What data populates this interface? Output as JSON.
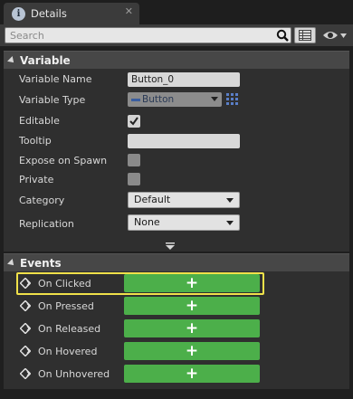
{
  "tab": {
    "label": "Details",
    "icon": "info-icon",
    "close_glyph": "✕"
  },
  "search": {
    "placeholder": "Search"
  },
  "variable_section": {
    "title": "Variable"
  },
  "variable_rows": {
    "variable_name": {
      "label": "Variable Name",
      "value": "Button_0"
    },
    "variable_type": {
      "label": "Variable Type",
      "value": "Button"
    },
    "editable": {
      "label": "Editable",
      "checked": true
    },
    "tooltip": {
      "label": "Tooltip",
      "value": ""
    },
    "expose_on_spawn": {
      "label": "Expose on Spawn",
      "checked": false
    },
    "private": {
      "label": "Private",
      "checked": false
    },
    "category": {
      "label": "Category",
      "value": "Default"
    },
    "replication": {
      "label": "Replication",
      "value": "None"
    }
  },
  "events_section": {
    "title": "Events"
  },
  "events": [
    {
      "label": "On Clicked",
      "button": "+",
      "highlighted": true
    },
    {
      "label": "On Pressed",
      "button": "+"
    },
    {
      "label": "On Released",
      "button": "+"
    },
    {
      "label": "On Hovered",
      "button": "+"
    },
    {
      "label": "On Unhovered",
      "button": "+"
    }
  ],
  "colors": {
    "add_button": "#4caf4a",
    "highlight": "#f0e14a",
    "panel": "#2f2f2f"
  }
}
